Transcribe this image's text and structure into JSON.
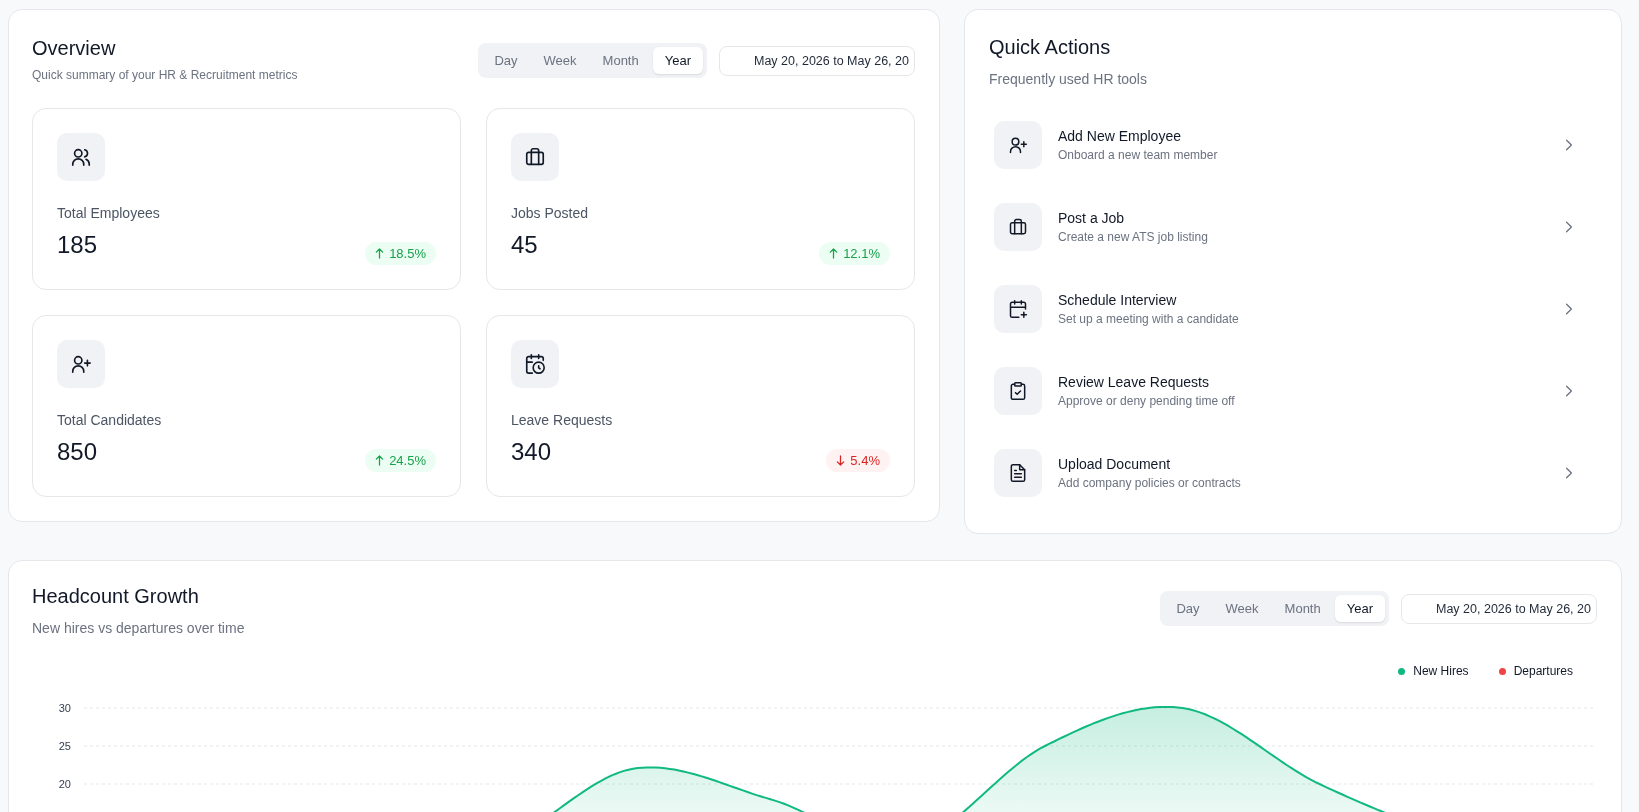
{
  "overview": {
    "title": "Overview",
    "subtitle": "Quick summary of your HR & Recruitment metrics",
    "periods": [
      {
        "label": "Day",
        "selected": false
      },
      {
        "label": "Week",
        "selected": false
      },
      {
        "label": "Month",
        "selected": false
      },
      {
        "label": "Year",
        "selected": true
      }
    ],
    "date_range": "May 20, 2026 to May 26, 20",
    "stats": [
      {
        "label": "Total Employees",
        "value": "185",
        "change": "18.5%",
        "kind": "up"
      },
      {
        "label": "Jobs Posted",
        "value": "45",
        "change": "12.1%",
        "kind": "up"
      },
      {
        "label": "Total Candidates",
        "value": "850",
        "change": "24.5%",
        "kind": "up"
      },
      {
        "label": "Leave Requests",
        "value": "340",
        "change": "5.4%",
        "kind": "down"
      }
    ]
  },
  "quick_actions": {
    "title": "Quick Actions",
    "subtitle": "Frequently used HR tools",
    "items": [
      {
        "title": "Add New Employee",
        "description": "Onboard a new team member"
      },
      {
        "title": "Post a Job",
        "description": "Create a new ATS job listing"
      },
      {
        "title": "Schedule Interview",
        "description": "Set up a meeting with a candidate"
      },
      {
        "title": "Review Leave Requests",
        "description": "Approve or deny pending time off"
      },
      {
        "title": "Upload Document",
        "description": "Add company policies or contracts"
      }
    ]
  },
  "headcount": {
    "title": "Headcount Growth",
    "subtitle": "New hires vs departures over time",
    "periods": [
      {
        "label": "Day",
        "selected": false
      },
      {
        "label": "Week",
        "selected": false
      },
      {
        "label": "Month",
        "selected": false
      },
      {
        "label": "Year",
        "selected": true
      }
    ],
    "date_range": "May 20, 2026 to May 26, 20",
    "chart": {
      "legend": [
        {
          "name": "New Hires",
          "color": "#10b981"
        },
        {
          "name": "Departures",
          "color": "#ef4444"
        }
      ],
      "y_labels": [
        "30",
        "25",
        "20"
      ]
    }
  }
}
